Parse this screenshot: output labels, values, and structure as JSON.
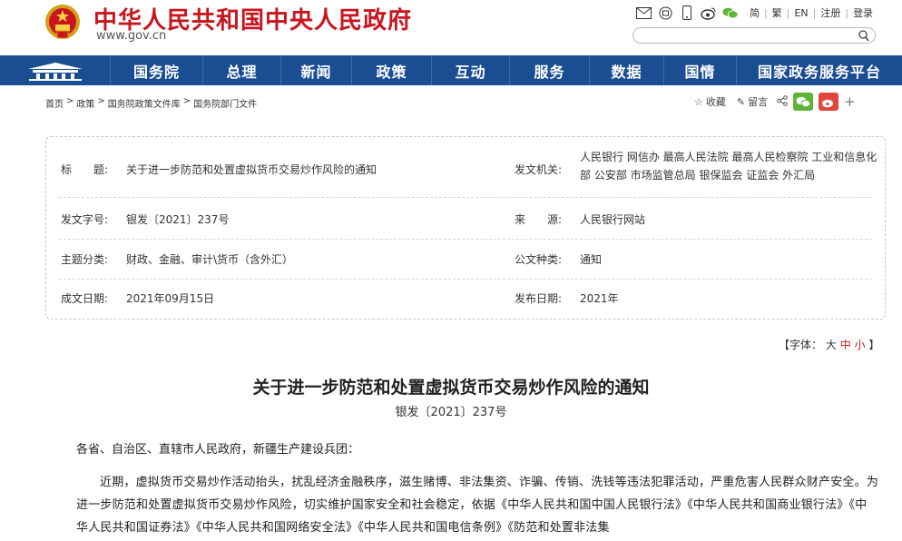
{
  "header": {
    "site_title": "中华人民共和国中央人民政府",
    "site_url": "www.gov.cn",
    "top_links": [
      "简",
      "繁",
      "EN",
      "注册",
      "登录"
    ],
    "search_placeholder": ""
  },
  "nav": {
    "items": [
      "国务院",
      "总理",
      "新闻",
      "政策",
      "互动",
      "服务",
      "数据",
      "国情",
      "国家政务服务平台"
    ]
  },
  "breadcrumb": [
    "首页",
    "政策",
    "国务院政策文件库",
    "国务院部门文件"
  ],
  "share": {
    "collect": "收藏",
    "comment": "留言"
  },
  "info": {
    "title_label": "标　　题:",
    "title_value": "关于进一步防范和处置虚拟货币交易炒作风险的通知",
    "issuer_label": "发文机关:",
    "issuer_value": "人民银行 网信办 最高人民法院 最高人民检察院 工业和信息化部 公安部 市场监管总局 银保监会 证监会 外汇局",
    "docno_label": "发文字号:",
    "docno_value": "银发〔2021〕237号",
    "source_label": "来　　源:",
    "source_value": "人民银行网站",
    "topic_label": "主题分类:",
    "topic_value": "财政、金融、审计\\货币（含外汇）",
    "type_label": "公文种类:",
    "type_value": "通知",
    "date_label": "成文日期:",
    "date_value": "2021年09月15日",
    "pub_label": "发布日期:",
    "pub_value": "2021年"
  },
  "font_size": {
    "prefix": "【字体：",
    "large": "大",
    "medium": "中",
    "small": "小",
    "suffix": "】"
  },
  "document": {
    "title": "关于进一步防范和处置虚拟货币交易炒作风险的通知",
    "number": "银发〔2021〕237号",
    "addressee": "各省、自治区、直辖市人民政府，新疆生产建设兵团：",
    "body": "近期，虚拟货币交易炒作活动抬头，扰乱经济金融秩序，滋生赌博、非法集资、诈骗、传销、洗钱等违法犯罪活动，严重危害人民群众财产安全。为进一步防范和处置虚拟货币交易炒作风险，切实维护国家安全和社会稳定，依据《中华人民共和国中国人民银行法》《中华人民共和国商业银行法》《中华人民共和国证券法》《中华人民共和国网络安全法》《中华人民共和国电信条例》《防范和处置非法集"
  },
  "colors": {
    "brand_red": "#c9151e",
    "nav_blue": "#1b4d92"
  }
}
